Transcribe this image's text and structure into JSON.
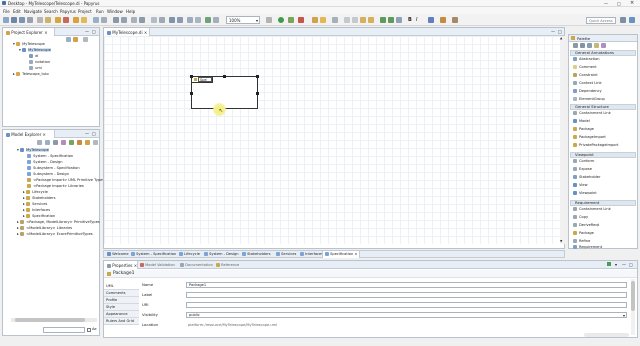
{
  "window": {
    "title": "Desktop - MyTelescope/Telescope.di - Papyrus"
  },
  "menu": [
    "File",
    "Edit",
    "Navigate",
    "Search",
    "Papyrus",
    "Project",
    "Run",
    "Window",
    "Help"
  ],
  "toolbar": {
    "zoom": "100%",
    "quick_access": "Quick Access"
  },
  "project_explorer": {
    "title": "Project Explorer",
    "items": [
      {
        "label": "MyTelescope",
        "depth": 0
      },
      {
        "label": "MyTelescope",
        "depth": 1
      },
      {
        "label": "di",
        "depth": 2
      },
      {
        "label": "notation",
        "depth": 2
      },
      {
        "label": "uml",
        "depth": 2
      },
      {
        "label": "Telescope_tuto",
        "depth": 0
      }
    ]
  },
  "model_explorer": {
    "title": "Model Explorer",
    "items": [
      {
        "label": "MyTelescope",
        "depth": 0
      },
      {
        "label": "System - Specification",
        "depth": 1
      },
      {
        "label": "System - Design",
        "depth": 1
      },
      {
        "label": "Subsystem - Specification",
        "depth": 1
      },
      {
        "label": "Subsystem - Design",
        "depth": 1
      },
      {
        "label": "<Package Import> UML Primitive Types",
        "depth": 1
      },
      {
        "label": "<Package Import> Libraries",
        "depth": 1
      },
      {
        "label": "Lifecycle",
        "depth": 1
      },
      {
        "label": "Stakeholders",
        "depth": 1
      },
      {
        "label": "Services",
        "depth": 1
      },
      {
        "label": "Interfaces",
        "depth": 1
      },
      {
        "label": "Specification",
        "depth": 1
      },
      {
        "label": "<Package, ModelLibrary> PrimitiveTypes",
        "depth": 0
      },
      {
        "label": "<ModelLibrary> Libraries",
        "depth": 0
      },
      {
        "label": "<ModelLibrary> EcorePrimitiveTypes",
        "depth": 0
      }
    ],
    "filter_label": "Ae"
  },
  "editor": {
    "tab": "MyTelescope.di",
    "package_name": "Spe"
  },
  "diagram_tabs": [
    "Welcome",
    "System - Specification",
    "Lifecycle",
    "System - Design",
    "Stakeholders",
    "Services",
    "Interfaces",
    "Specification"
  ],
  "palette": {
    "title": "Palette",
    "groups": [
      {
        "name": "General Annotations",
        "items": [
          "Abstraction",
          "Comment",
          "Constraint",
          "Context Link",
          "Dependency",
          "ElementGroup"
        ]
      },
      {
        "name": "General Structure",
        "items": [
          "Containment Link",
          "Model",
          "Package",
          "PackageImport",
          "PrivatePackageImport"
        ]
      },
      {
        "name": "Viewpoint",
        "items": [
          "Conform",
          "Expose",
          "Stakeholder",
          "View",
          "Viewpoint"
        ]
      },
      {
        "name": "Requirement",
        "items": [
          "Containment Link",
          "Copy",
          "DeriveReqt",
          "Package",
          "Refine",
          "Requirement"
        ]
      }
    ]
  },
  "properties": {
    "tabs": [
      "Properties",
      "Model Validation",
      "Documentation",
      "Reference"
    ],
    "header": "Package1",
    "categories": [
      "UML",
      "Comments",
      "Profile",
      "Style",
      "Appearance",
      "Rulers And Grid"
    ],
    "fields": [
      {
        "label": "Name",
        "value": "Package1"
      },
      {
        "label": "Label",
        "value": ""
      },
      {
        "label": "URI",
        "value": ""
      },
      {
        "label": "Visibility",
        "value": "public"
      },
      {
        "label": "Location",
        "value": "platform:/resource/MyTelescope/MyTelescope.uml"
      }
    ]
  },
  "colors": {
    "accent": "#3a7bd5",
    "package_icon": "#c9a94a"
  }
}
